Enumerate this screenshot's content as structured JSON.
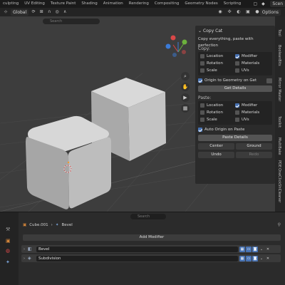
{
  "workspace_tabs": [
    "culpting",
    "UV Editing",
    "Texture Paint",
    "Shading",
    "Animation",
    "Rendering",
    "Compositing",
    "Geometry Nodes",
    "Scripting"
  ],
  "scene_label": "Scen",
  "viewport_header": {
    "transform_orientation": "Global",
    "options_label": "Options",
    "search_placeholder": "Search"
  },
  "npanel": {
    "title": "Copy Cat",
    "description": "Copy everything, paste with perfection",
    "copy": {
      "label": "Copy:",
      "items": [
        {
          "label": "Location",
          "checked": false
        },
        {
          "label": "Modifier",
          "checked": true
        },
        {
          "label": "Rotation",
          "checked": false
        },
        {
          "label": "Materials",
          "checked": false
        },
        {
          "label": "Scale",
          "checked": false
        },
        {
          "label": "UVs",
          "checked": false
        }
      ],
      "origin_label": "Origin to Geometry on Get",
      "get_button": "Get Details"
    },
    "paste": {
      "label": "Paste:",
      "items": [
        {
          "label": "Location",
          "checked": false
        },
        {
          "label": "Modifier",
          "checked": true
        },
        {
          "label": "Rotation",
          "checked": false
        },
        {
          "label": "Materials",
          "checked": false
        },
        {
          "label": "Scale",
          "checked": false
        },
        {
          "label": "UVs",
          "checked": false
        }
      ],
      "auto_origin_label": "Auto Origin on Paste",
      "paste_button": "Paste Details"
    },
    "center_button": "Center",
    "ground_button": "Ground",
    "undo_button": "Undo",
    "redo_button": "Redo"
  },
  "side_tabs": [
    "Tool",
    "BooleanBits",
    "Mirror Master",
    "Toolkit",
    "MultiBake",
    "PDE",
    "OneClickShi",
    "Cleaner"
  ],
  "properties": {
    "search_placeholder": "Search",
    "object_name": "Cube.001",
    "modifier_context": "Bevel",
    "add_modifier": "Add Modifier",
    "modifiers": [
      {
        "name": "Bevel"
      },
      {
        "name": "Subdivision"
      }
    ]
  }
}
